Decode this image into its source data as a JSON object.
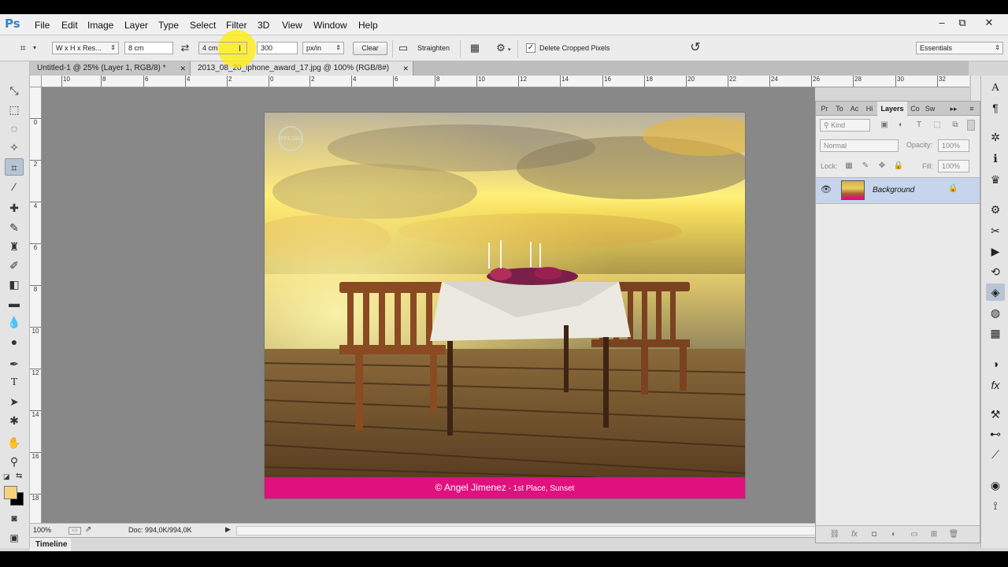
{
  "app": {
    "logo": "Ps"
  },
  "menu": [
    "File",
    "Edit",
    "Image",
    "Layer",
    "Type",
    "Select",
    "Filter",
    "3D",
    "View",
    "Window",
    "Help"
  ],
  "window_controls": {
    "minimize": "–",
    "restore": "⧉",
    "close": "✕"
  },
  "options_bar": {
    "preset": "W x H x Res...",
    "width": "8 cm",
    "height": "4 cm",
    "resolution": "300",
    "resolution_unit": "px/in",
    "clear_label": "Clear",
    "straighten_label": "Straighten",
    "delete_cropped_label": "Delete Cropped Pixels",
    "delete_cropped_checked": true,
    "workspace": "Essentials"
  },
  "tabs": [
    {
      "label": "Untitled-1 @ 25% (Layer 1, RGB/8) *",
      "close": "✕",
      "active": false
    },
    {
      "label": "2013_08_20_iphone_award_17.jpg @ 100% (RGB/8#)",
      "close": "✕",
      "active": true
    }
  ],
  "ruler_h": [
    "10",
    "8",
    "6",
    "4",
    "2",
    "0",
    "2",
    "4",
    "6",
    "8",
    "10",
    "12",
    "14",
    "16",
    "18",
    "20",
    "22",
    "24",
    "26",
    "28",
    "30",
    "32"
  ],
  "ruler_v": [
    "0",
    "2",
    "4",
    "6",
    "8",
    "10",
    "12",
    "14",
    "16",
    "18"
  ],
  "photo": {
    "caption_name": "© Angel Jimenez",
    "caption_detail": " - 1st Place, Sunset",
    "watermark": "IPPA 2013"
  },
  "status": {
    "zoom": "100%",
    "doc": "Doc: 994,0K/994,0K"
  },
  "timeline_label": "Timeline",
  "panel": {
    "tabs": [
      "Pr",
      "To",
      "Ac",
      "Hi",
      "Layers",
      "Co",
      "Sw"
    ],
    "active_tab": "Layers",
    "kind": "Kind",
    "blend_mode": "Normal",
    "opacity_label": "Opacity:",
    "opacity": "100%",
    "lock_label": "Lock:",
    "fill_label": "Fill:",
    "fill": "100%",
    "layer_name": "Background"
  },
  "colors": {
    "caption_bar": "#e0107e",
    "foreground_swatch": "#f6d27a",
    "highlight": "#ffee00"
  }
}
